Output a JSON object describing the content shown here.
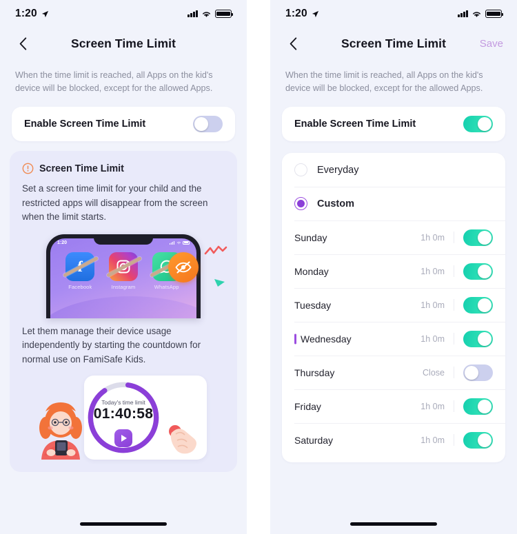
{
  "status_bar": {
    "time": "1:20",
    "icons": [
      "location-arrow-icon",
      "cellular-signal-icon",
      "wifi-icon",
      "battery-icon"
    ]
  },
  "nav": {
    "back_icon": "chevron-left-icon",
    "title": "Screen Time Limit",
    "save_label": "Save"
  },
  "description": "When the time limit is reached, all Apps on the kid's device will be blocked, except for the allowed Apps.",
  "enable_row": {
    "label": "Enable Screen Time Limit",
    "left_state": "off",
    "right_state": "on"
  },
  "info_card": {
    "icon": "warning-exclamation-icon",
    "title": "Screen Time Limit",
    "paragraph1": "Set a screen time limit for your child and the restricted apps will disappear from the screen when the limit starts.",
    "paragraph2": "Let them manage their device usage independently by starting the countdown for normal use on FamiSafe Kids."
  },
  "phone_mock": {
    "status_time": "1:20",
    "apps": [
      {
        "name": "Facebook",
        "glyph": "f",
        "style": "fb"
      },
      {
        "name": "Instagram",
        "glyph": "▢",
        "style": "ig"
      },
      {
        "name": "WhatsApp",
        "glyph": "●",
        "style": "wa"
      }
    ],
    "badge_icon": "blocked-eye-icon"
  },
  "timer": {
    "label": "Today's time limit",
    "value": "01:40:58",
    "play_icon": "play-icon",
    "progress_percent": 88,
    "ring_color": "#8b3fd8",
    "ring_track_color": "#dcdcea"
  },
  "schedule": {
    "options": [
      {
        "label": "Everyday",
        "selected": false
      },
      {
        "label": "Custom",
        "selected": true
      }
    ],
    "days": [
      {
        "name": "Sunday",
        "value": "1h 0m",
        "enabled": true,
        "today": false
      },
      {
        "name": "Monday",
        "value": "1h 0m",
        "enabled": true,
        "today": false
      },
      {
        "name": "Tuesday",
        "value": "1h 0m",
        "enabled": true,
        "today": false
      },
      {
        "name": "Wednesday",
        "value": "1h 0m",
        "enabled": true,
        "today": true
      },
      {
        "name": "Thursday",
        "value": "Close",
        "enabled": false,
        "today": false
      },
      {
        "name": "Friday",
        "value": "1h 0m",
        "enabled": true,
        "today": false
      },
      {
        "name": "Saturday",
        "value": "1h 0m",
        "enabled": true,
        "today": false
      }
    ]
  },
  "colors": {
    "background": "#f1f3fb",
    "card": "#ffffff",
    "toggle_on": "#22d5af",
    "toggle_off": "#ccd0ee",
    "accent_purple": "#8b3fd8",
    "save_link": "#c39ae0",
    "info_card_bg": "#e9eafa",
    "muted_text": "#a9abba"
  },
  "home_indicator": "home-indicator-bar"
}
